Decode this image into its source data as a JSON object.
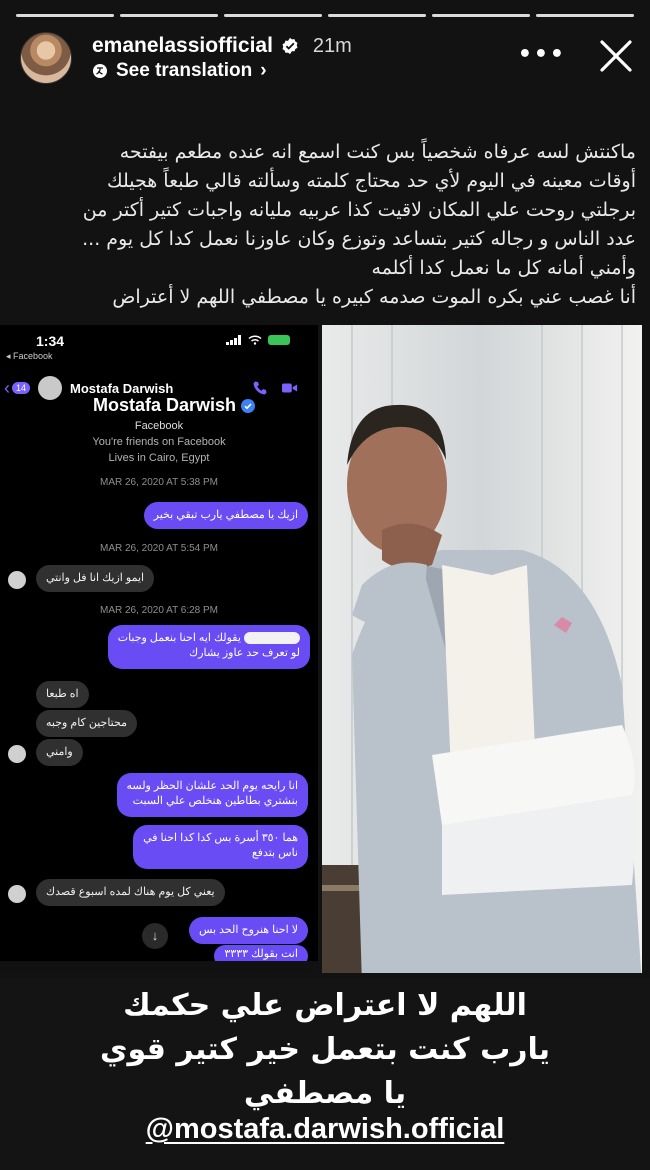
{
  "story": {
    "progress_segments": 6,
    "username": "emanelassiofficial",
    "time": "21m",
    "translate_label": "See translation",
    "translate_chevron": "›",
    "more_label": "•••",
    "verified_icon": "verified-badge-icon",
    "close_icon": "close-icon"
  },
  "caption": {
    "lines": [
      "ماكنتش لسه عرفاه شخصياً بس كنت اسمع انه عنده مطعم بيفتحه",
      "أوقات معينه في اليوم لأي حد محتاج كلمته وسألته قالي طبعاً هجيلك",
      "برجلتي روحت علي المكان لاقيت كذا عربيه مليانه واجبات كتير أكتر من",
      "عدد الناس و رجاله كتير بتساعد وتوزع وكان عاوزنا نعمل كدا كل يوم ...",
      "وأمني أمانه كل ما نعمل كدا أكلمه",
      "أنا غصب عني بكره الموت صدمه كبيره يا مصطفي اللهم لا أعتراض"
    ]
  },
  "messenger": {
    "status_time": "1:34",
    "status_back": "◂ Facebook",
    "unread_count": "14",
    "contact_name": "Mostafa Darwish",
    "profile_platform": "Facebook",
    "profile_friends": "You're friends on Facebook",
    "profile_location": "Lives in Cairo, Egypt",
    "dates": [
      "MAR 26, 2020 AT 5:38 PM",
      "MAR 26, 2020 AT 5:54 PM",
      "MAR 26, 2020 AT 6:28 PM"
    ],
    "messages": [
      "ازيك يا مصطفي يارب تبقي بخير",
      "ايمو ازيك انا فل وانتي",
      "يقولك ايه احنا بنعمل وجبات",
      "لو تعرف حد عاوز يشارك",
      "اه طبعا",
      "محتاجين كام وجبه",
      "وامني",
      "انا رايحه يوم الحد علشان الحظر ولسه",
      "بنشتري بطاطين هنخلص علي السبت",
      "هما ٣٥٠ أسرة بس كدا كدا احنا في",
      "ناس بتدفع",
      "يعني كل يوم هناك لمده اسبوع قصدك",
      "لا احنا هنروح الحد بس",
      "انت بقولك ٣٣٣٣"
    ],
    "scroll_down_glyph": "↓"
  },
  "photo": {
    "subject": "man-in-light-suit-photo"
  },
  "bottom_caption": {
    "line1": "اللهم لا اعتراض علي حكمك",
    "line2": "يارب كنت بتعمل خير كتير قوي",
    "line3": "يا مصطفي",
    "mention": "@mostafa.darwish.official"
  },
  "colors": {
    "messenger_accent": "#6a4cf5",
    "background": "#121212"
  }
}
